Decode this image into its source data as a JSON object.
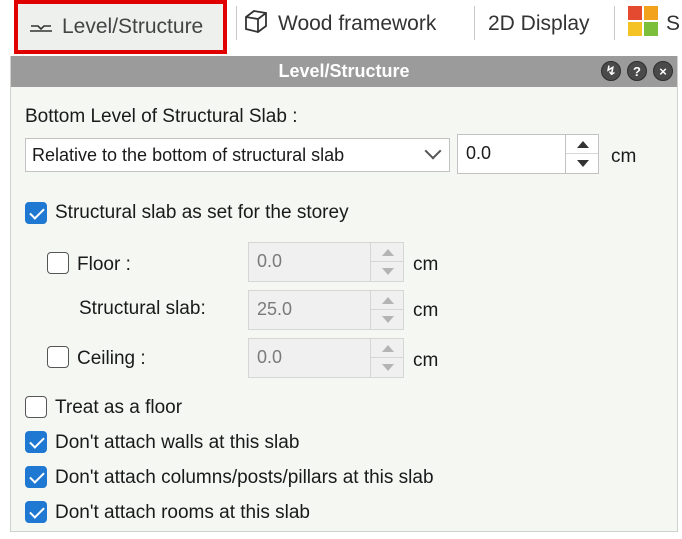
{
  "tabs": [
    {
      "label": "Level/Structure",
      "icon": "level-structure-icon"
    },
    {
      "label": "Wood framework",
      "icon": "wood-framework-icon"
    },
    {
      "label": "2D Display",
      "icon": "2d-display-icon"
    },
    {
      "label": "S",
      "icon": "color-squares-icon"
    }
  ],
  "panel": {
    "title": "Level/Structure",
    "header_buttons": [
      "pin-icon",
      "help-icon",
      "close-icon"
    ]
  },
  "bottom_level": {
    "label": "Bottom Level of Structural Slab :",
    "select_value": "Relative to the bottom of structural slab",
    "offset_value": "0.0",
    "unit": "cm"
  },
  "structural_slab_storey": {
    "label": "Structural slab as set for the storey",
    "checked": true
  },
  "floor": {
    "label": "Floor :",
    "checked": false,
    "value": "0.0",
    "unit": "cm"
  },
  "structural_slab": {
    "label": "Structural slab:",
    "value": "25.0",
    "unit": "cm"
  },
  "ceiling": {
    "label": "Ceiling :",
    "checked": false,
    "value": "0.0",
    "unit": "cm"
  },
  "options": [
    {
      "label": "Treat as a floor",
      "checked": false
    },
    {
      "label": "Don't attach walls at this slab",
      "checked": true
    },
    {
      "label": "Don't attach columns/posts/pillars at this slab",
      "checked": true
    },
    {
      "label": "Don't attach rooms at this slab",
      "checked": true
    }
  ],
  "colors": {
    "accent": "#1f78d1",
    "highlight_border": "#e00000",
    "header": "#9b9b9b",
    "panel_bg": "#f4f7f2"
  }
}
